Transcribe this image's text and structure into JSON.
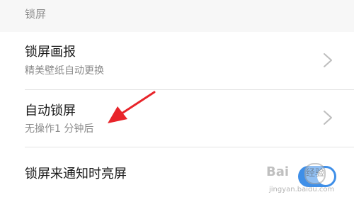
{
  "section": {
    "header_label": "锁屏"
  },
  "rows": [
    {
      "title": "锁屏画报",
      "subtitle": "精美壁纸自动更换",
      "control": "chevron-right-icon"
    },
    {
      "title": "自动锁屏",
      "subtitle": "无操作1 分钟后",
      "control": "chevron-right-icon"
    },
    {
      "title": "锁屏来通知时亮屏",
      "control": "toggle",
      "toggle_on": true
    }
  ],
  "annotation": {
    "color": "#e8242a",
    "points_to": "自动锁屏"
  },
  "watermark": {
    "brand": "Bai",
    "badge": "经验",
    "url": "jingyan.baidu.com"
  },
  "colors": {
    "header_bg": "#f7f7f7",
    "toggle_on": "#3f8fe8",
    "title_text": "#1a1a1a",
    "subtitle_text": "#8a8a8a"
  }
}
